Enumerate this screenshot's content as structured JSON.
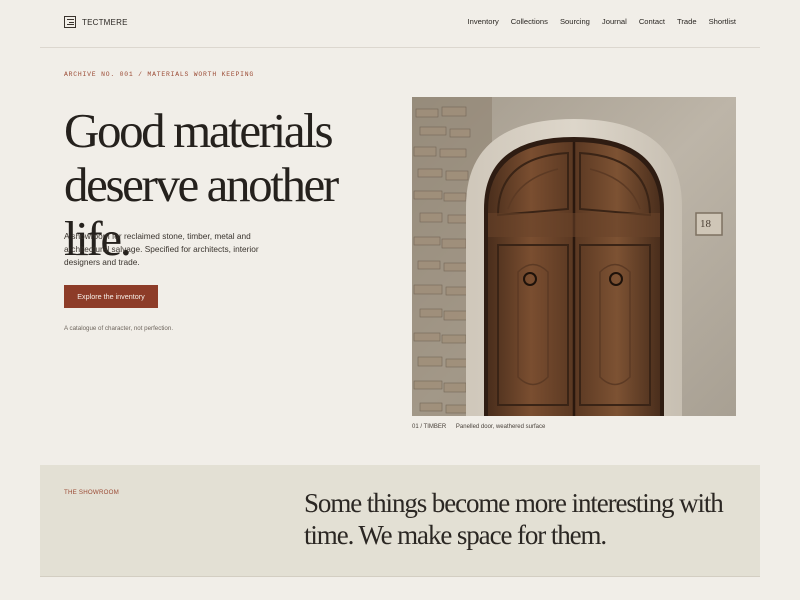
{
  "brand": {
    "name": "TECTMERE"
  },
  "nav": {
    "items": [
      "Inventory",
      "Collections",
      "Sourcing",
      "Journal",
      "Contact",
      "Trade",
      "Shortlist"
    ]
  },
  "hero": {
    "eyebrow": "ARCHIVE NO. 001 / MATERIALS WORTH KEEPING",
    "headline_line1": "Good materials",
    "headline_line2": "deserve another life.",
    "intro": "A showroom for reclaimed stone, timber, metal and architectural salvage. Specified for architects, interior designers and trade.",
    "cta_label": "Explore the inventory",
    "tagline": "A catalogue of character, not perfection."
  },
  "feature_image": {
    "tag": "01 / TIMBER",
    "caption": "Panelled door, weathered surface",
    "house_number": "18"
  },
  "showroom": {
    "label": "THE SHOWROOM",
    "quote": "Some things become more interesting with time. We make space for them."
  },
  "colors": {
    "background": "#f1eee8",
    "accent": "#8d3c28",
    "band": "#e3e0d4",
    "text": "#2b2723"
  }
}
